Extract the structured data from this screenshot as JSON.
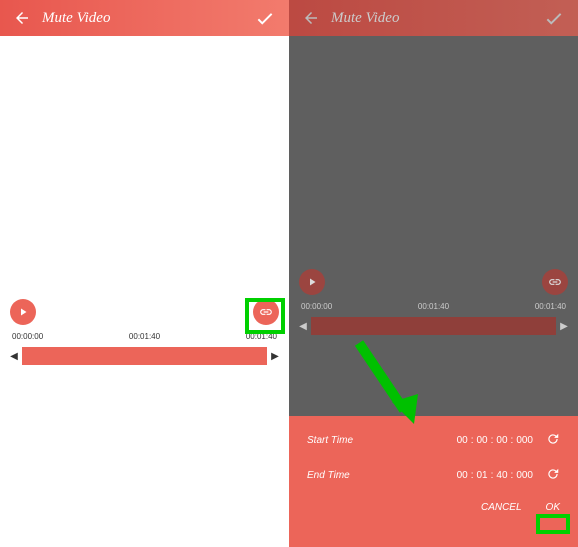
{
  "left": {
    "header": {
      "title": "Mute Video"
    },
    "times": {
      "start": "00:00:00",
      "mid": "00:01:40",
      "end": "00:01:40"
    }
  },
  "right": {
    "header": {
      "title": "Mute Video"
    },
    "times": {
      "start": "00:00:00",
      "mid": "00:01:40",
      "end": "00:01:40"
    },
    "sheet": {
      "start_label": "Start Time",
      "start_hh": "00",
      "start_mm": "00",
      "start_ss": "00",
      "start_ms": "000",
      "end_label": "End Time",
      "end_hh": "00",
      "end_mm": "01",
      "end_ss": "40",
      "end_ms": "000",
      "cancel": "CANCEL",
      "ok": "OK"
    }
  }
}
